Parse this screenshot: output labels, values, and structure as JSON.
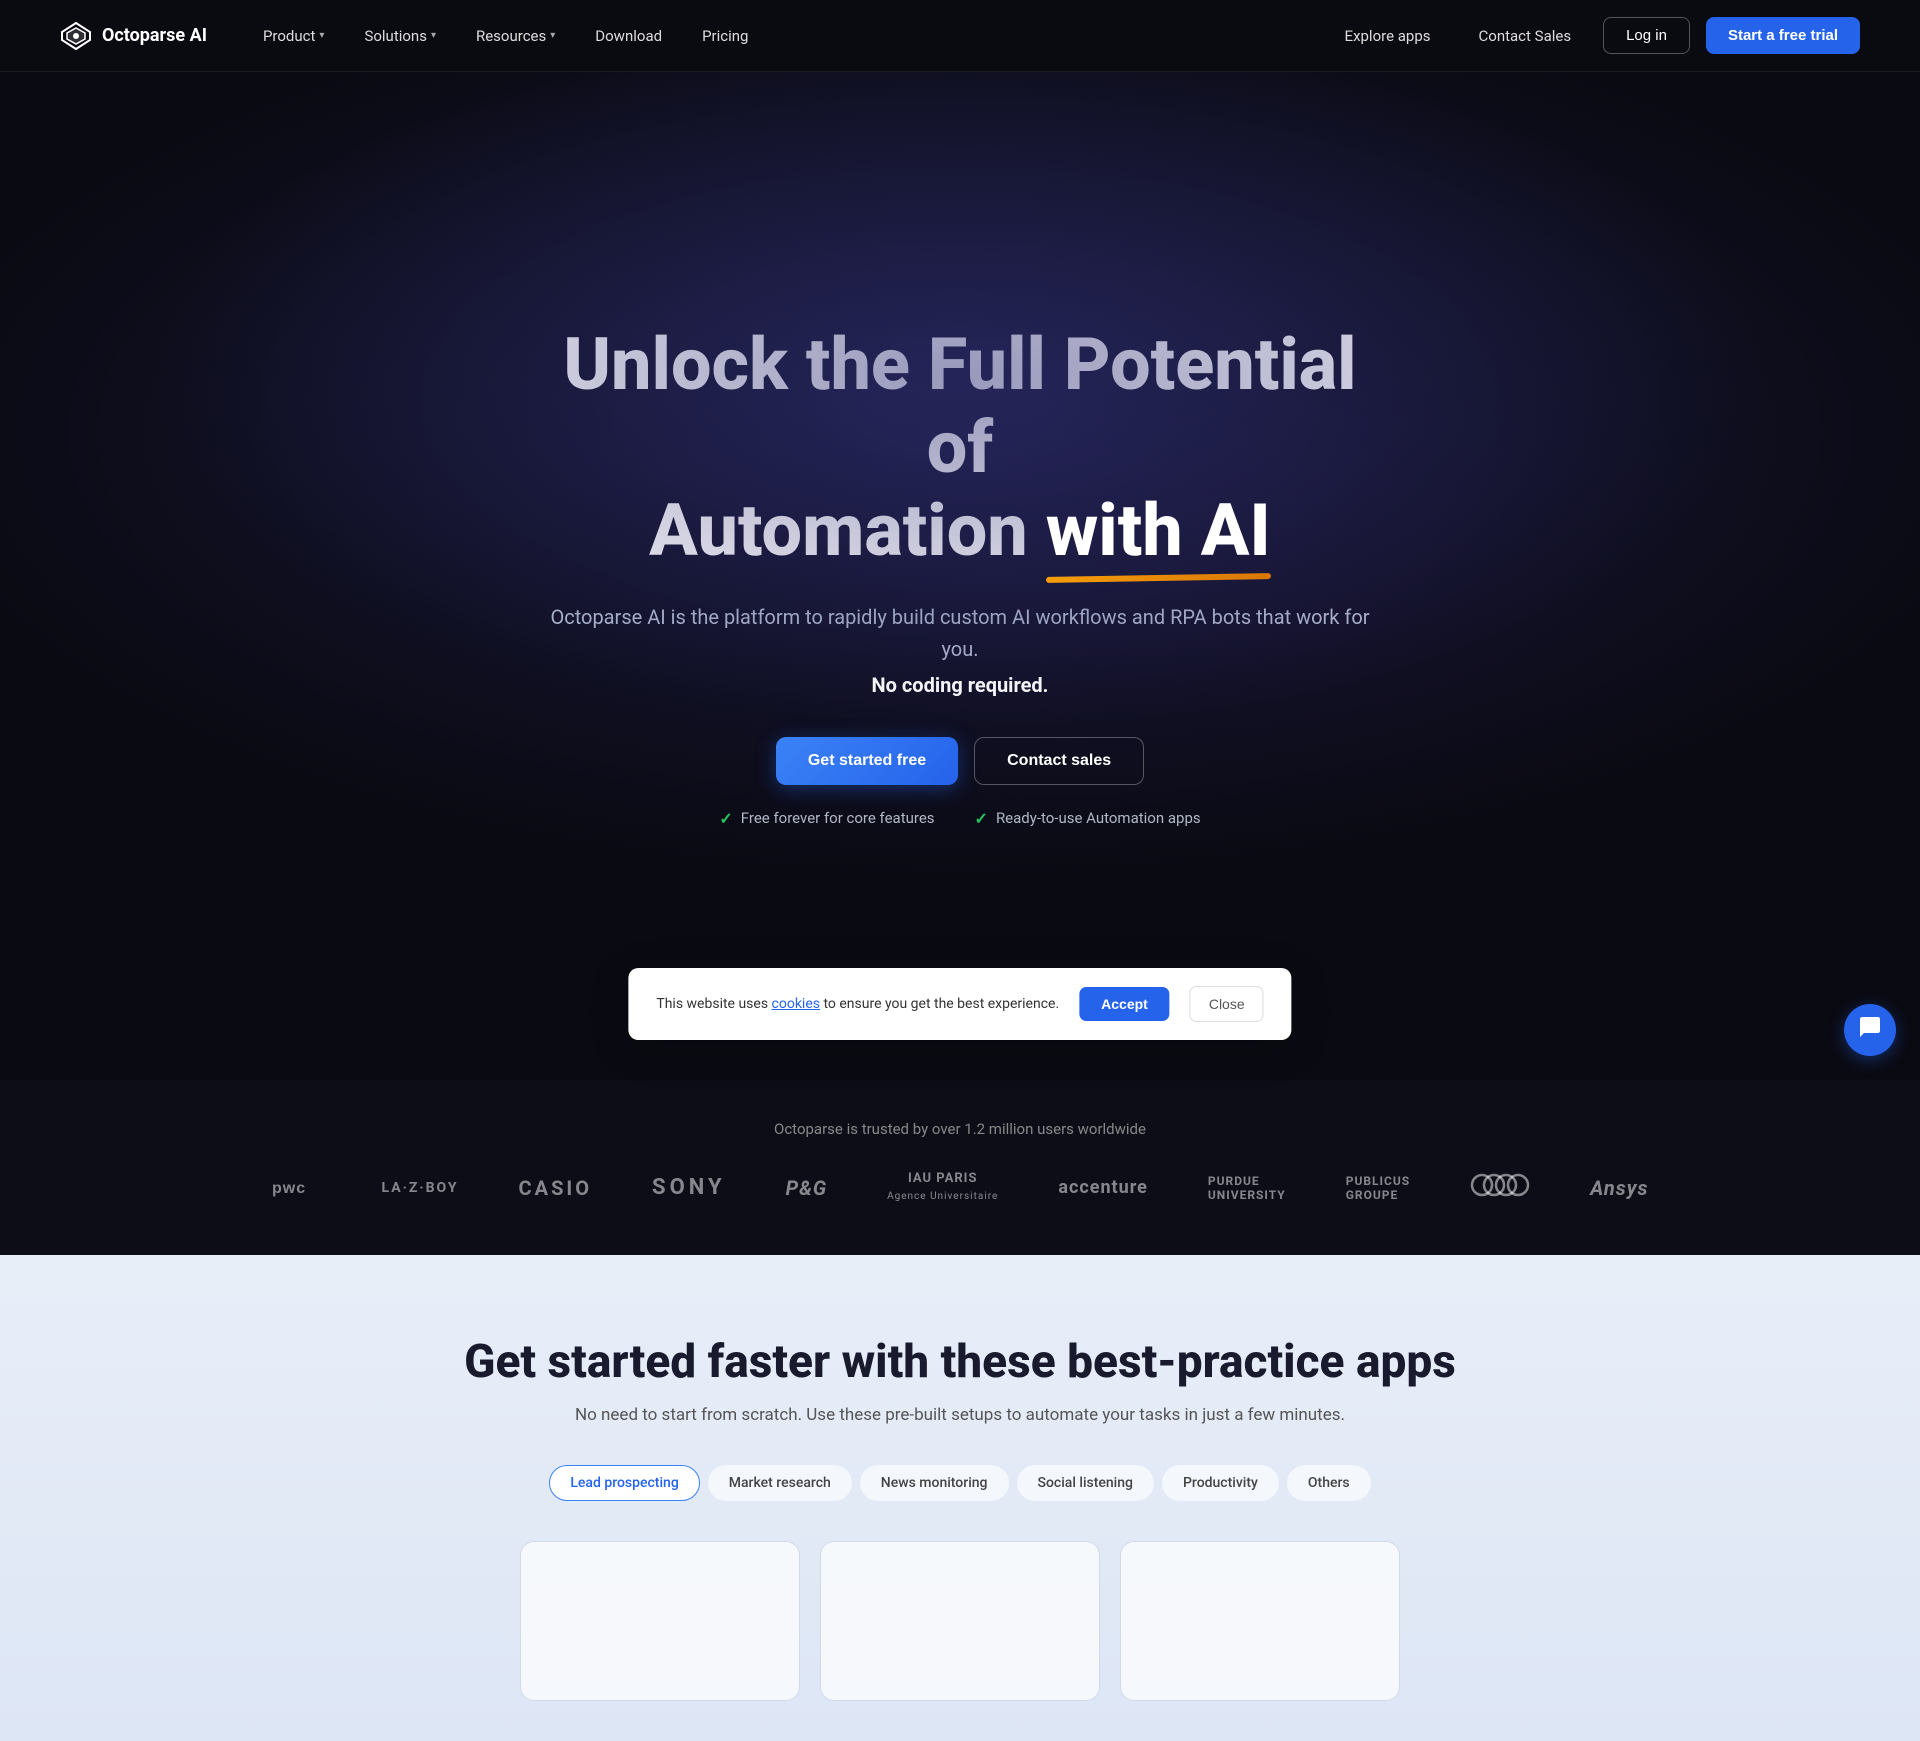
{
  "brand": {
    "name": "Octoparse AI",
    "logo_alt": "Octoparse AI Logo"
  },
  "navbar": {
    "product_label": "Product",
    "solutions_label": "Solutions",
    "resources_label": "Resources",
    "download_label": "Download",
    "pricing_label": "Pricing",
    "explore_label": "Explore apps",
    "contact_sales_label": "Contact Sales",
    "login_label": "Log in",
    "trial_label": "Start a free trial"
  },
  "hero": {
    "title_line1": "Unlock the Full Potential of",
    "title_line2_start": "Automation ",
    "title_line2_highlight": "with AI",
    "subtitle": "Octoparse AI is the platform to rapidly build custom AI workflows and RPA bots that work for you.",
    "subtitle_bold": "No coding required.",
    "btn_get_started": "Get started free",
    "btn_contact_sales": "Contact sales",
    "feature1": "Free forever for core features",
    "feature2": "Ready-to-use Automation apps"
  },
  "trusted": {
    "text": "Octoparse is trusted by over 1.2 million users worldwide",
    "logos": [
      {
        "name": "PwC",
        "style": "pwc"
      },
      {
        "name": "LA·Z·BOY",
        "style": "lazyboy"
      },
      {
        "name": "CASIO",
        "style": "casio"
      },
      {
        "name": "SONY",
        "style": "sony"
      },
      {
        "name": "P&G",
        "style": "pg"
      },
      {
        "name": "IAU PARIS",
        "style": "iau"
      },
      {
        "name": "accenture",
        "style": "accenture"
      },
      {
        "name": "PURDUE UNIVERSITY",
        "style": "purdue"
      },
      {
        "name": "PUBLICUS GROUPE",
        "style": "publicus"
      },
      {
        "name": "AUDI",
        "style": "audi"
      },
      {
        "name": "Ansys",
        "style": "ansys"
      }
    ]
  },
  "second_section": {
    "title": "Get started faster with these best-practice apps",
    "subtitle": "No need to start from scratch. Use these pre-built setups to automate your tasks in just a few minutes.",
    "tabs": [
      {
        "label": "Lead prospecting",
        "active": true
      },
      {
        "label": "Market research",
        "active": false
      },
      {
        "label": "News monitoring",
        "active": false
      },
      {
        "label": "Social listening",
        "active": false
      },
      {
        "label": "Productivity",
        "active": false
      },
      {
        "label": "Others",
        "active": false
      }
    ]
  },
  "cookie": {
    "text": "This website uses ",
    "link_text": "cookies",
    "text_after": " to ensure you get the best experience.",
    "accept_label": "Accept",
    "close_label": "Close"
  },
  "chat": {
    "icon": "💬"
  }
}
